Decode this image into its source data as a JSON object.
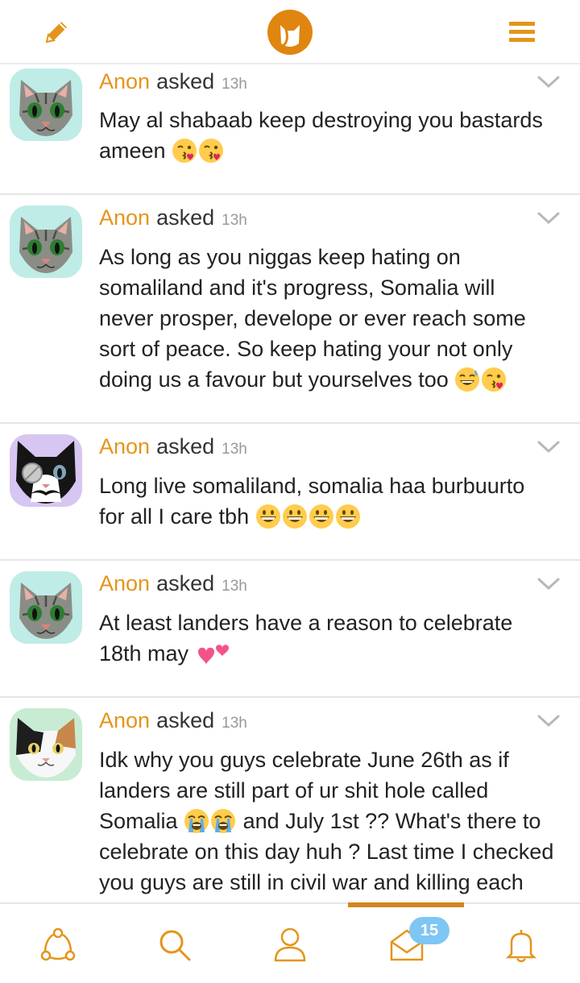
{
  "colors": {
    "accent": "#e5941a",
    "badge": "#7ec6f3"
  },
  "topbar": {
    "left_icon": "pencil-icon",
    "center_icon": "app-logo",
    "right_icon": "hamburger-menu-icon"
  },
  "questions": [
    {
      "author": "Anon",
      "action": "asked",
      "time": "13h",
      "avatar": "tabby-cat-avatar",
      "lines": [
        "May al shabaab keep destroying you bastards",
        "ameen"
      ],
      "emojis": [
        "kissing-heart",
        "kissing-heart"
      ]
    },
    {
      "author": "Anon",
      "action": "asked",
      "time": "13h",
      "avatar": "tabby-cat-avatar",
      "lines": [
        "As long as you niggas keep hating on",
        "somaliland and it's progress, Somalia will",
        "never prosper, develope or ever reach some",
        "sort of peace. So keep hating your not only",
        "doing us a favour but yourselves too"
      ],
      "emojis": [
        "sweat-smile",
        "kissing-heart"
      ]
    },
    {
      "author": "Anon",
      "action": "asked",
      "time": "13h",
      "avatar": "tuxedo-cat-avatar",
      "lines": [
        "Long live somaliland, somalia haa burbuurto",
        "for all I care tbh"
      ],
      "emojis": [
        "grinning",
        "grinning",
        "grinning",
        "grinning"
      ]
    },
    {
      "author": "Anon",
      "action": "asked",
      "time": "13h",
      "avatar": "tabby-cat-avatar",
      "lines": [
        "At least landers have a reason to celebrate",
        "18th may"
      ],
      "emojis": [
        "two-hearts"
      ]
    },
    {
      "author": "Anon",
      "action": "asked",
      "time": "13h",
      "avatar": "calico-cat-avatar",
      "lines": [
        "Idk why you guys celebrate June 26th as if",
        "landers are still part of ur shit hole called",
        "Somalia",
        "and July 1st ?? What's there to",
        "celebrate on this day huh ? Last time I checked",
        "you guys are still in civil war and killing each"
      ],
      "emojis": [
        "sob",
        "sob"
      ]
    }
  ],
  "bottombar": {
    "items": [
      "network-icon",
      "search-icon",
      "profile-icon",
      "inbox-icon",
      "bell-icon"
    ],
    "inbox_badge": "15",
    "active": "inbox"
  }
}
